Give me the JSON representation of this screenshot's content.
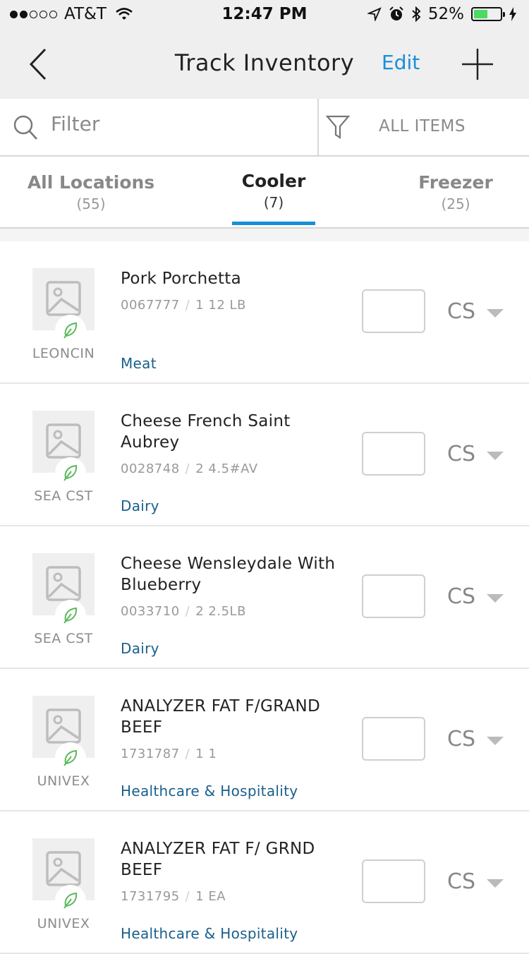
{
  "status_bar": {
    "carrier": "AT&T",
    "time": "12:47 PM",
    "battery": "52%",
    "battery_level": 0.52,
    "battery_color": "#4cd964"
  },
  "nav": {
    "title": "Track Inventory",
    "edit_label": "Edit",
    "back_icon": "chevron-left-icon",
    "add_icon": "plus-icon"
  },
  "search": {
    "placeholder": "Filter",
    "value": "",
    "filter_label": "ALL ITEMS"
  },
  "tabs": [
    {
      "label": "All Locations",
      "count": "(55)",
      "active": false
    },
    {
      "label": "Cooler",
      "count": "(7)",
      "active": true
    },
    {
      "label": "Freezer",
      "count": "(25)",
      "active": false
    }
  ],
  "accent_color": "#1a8fd8",
  "category_color": "#1a5f8c",
  "items": [
    {
      "name": "Pork Porchetta",
      "code": "0067777",
      "pack": "1 12 LB",
      "brand": "LEONCIN",
      "category": "Meat",
      "unit": "CS"
    },
    {
      "name": "Cheese French Saint Aubrey",
      "code": "0028748",
      "pack": "2 4.5#AV",
      "brand": "SEA CST",
      "category": "Dairy",
      "unit": "CS"
    },
    {
      "name": "Cheese Wensleydale With Blueberry",
      "code": "0033710",
      "pack": "2 2.5LB",
      "brand": "SEA CST",
      "category": "Dairy",
      "unit": "CS"
    },
    {
      "name": "ANALYZER FAT F/GRAND BEEF",
      "code": "1731787",
      "pack": "1 1",
      "brand": "UNIVEX",
      "category": "Healthcare & Hospitality",
      "unit": "CS"
    },
    {
      "name": "ANALYZER FAT F/ GRND BEEF",
      "code": "1731795",
      "pack": "1 EA",
      "brand": "UNIVEX",
      "category": "Healthcare & Hospitality",
      "unit": "CS"
    }
  ]
}
